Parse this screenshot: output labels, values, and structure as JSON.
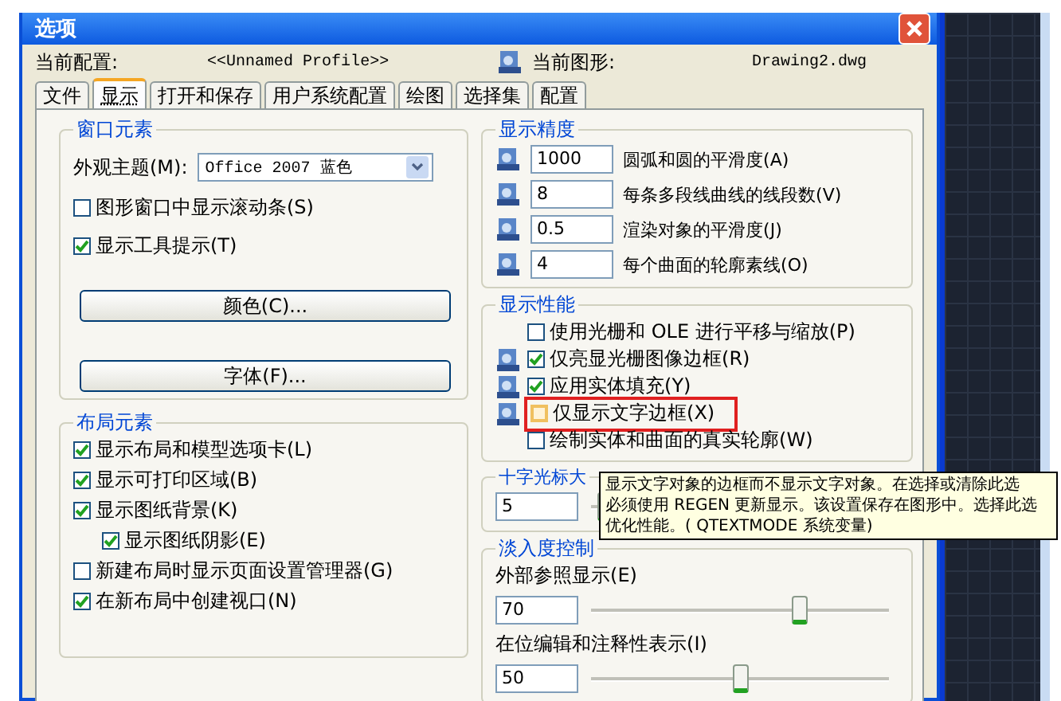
{
  "window": {
    "title": "选项"
  },
  "profile": {
    "label": "当前配置:",
    "value": "<<Unnamed Profile>>",
    "drawing_label": "当前图形:",
    "drawing_value": "Drawing2.dwg"
  },
  "tabs": [
    {
      "label": "文件",
      "selected": false
    },
    {
      "label": "显示",
      "selected": true
    },
    {
      "label": "打开和保存",
      "selected": false
    },
    {
      "label": "用户系统配置",
      "selected": false
    },
    {
      "label": "绘图",
      "selected": false
    },
    {
      "label": "选择集",
      "selected": false
    },
    {
      "label": "配置",
      "selected": false
    }
  ],
  "window_elements": {
    "title": "窗口元素",
    "theme_label": "外观主题(M):",
    "theme_value": "Office 2007 蓝色",
    "checks": [
      {
        "label": "图形窗口中显示滚动条(S)",
        "checked": false
      },
      {
        "label": "显示工具提示(T)",
        "checked": true
      }
    ],
    "buttons": [
      "颜色(C)...",
      "字体(F)..."
    ]
  },
  "layout_elements": {
    "title": "布局元素",
    "checks": [
      {
        "label": "显示布局和模型选项卡(L)",
        "checked": true,
        "indented": false
      },
      {
        "label": "显示可打印区域(B)",
        "checked": true,
        "indented": false
      },
      {
        "label": "显示图纸背景(K)",
        "checked": true,
        "indented": false
      },
      {
        "label": "显示图纸阴影(E)",
        "checked": true,
        "indented": true
      },
      {
        "label": "新建布局时显示页面设置管理器(G)",
        "checked": false,
        "indented": false
      },
      {
        "label": "在新布局中创建视口(N)",
        "checked": true,
        "indented": false
      }
    ]
  },
  "resolution": {
    "title": "显示精度",
    "rows": [
      {
        "value": "1000",
        "label": "圆弧和圆的平滑度(A)"
      },
      {
        "value": "8",
        "label": "每条多段线曲线的线段数(V)"
      },
      {
        "value": "0.5",
        "label": "渲染对象的平滑度(J)"
      },
      {
        "value": "4",
        "label": "每个曲面的轮廓素线(O)"
      }
    ]
  },
  "performance": {
    "title": "显示性能",
    "checks": [
      {
        "label": "使用光栅和 OLE 进行平移与缩放(P)",
        "checked": false,
        "saved_icon": false,
        "highlighted": false
      },
      {
        "label": "仅亮显光栅图像边框(R)",
        "checked": true,
        "saved_icon": true,
        "highlighted": false
      },
      {
        "label": "应用实体填充(Y)",
        "checked": true,
        "saved_icon": true,
        "highlighted": false
      },
      {
        "label": "仅显示文字边框(X)",
        "checked": false,
        "saved_icon": true,
        "highlighted": true
      },
      {
        "label": "绘制实体和曲面的真实轮廓(W)",
        "checked": false,
        "saved_icon": false,
        "highlighted": false
      }
    ]
  },
  "crosshair": {
    "title": "十字光标大",
    "value": "5",
    "level": 0.05
  },
  "fade": {
    "title": "淡入度控制",
    "rows": [
      {
        "label": "外部参照显示(E)",
        "value": "70",
        "level": 0.7
      },
      {
        "label": "在位编辑和注释性表示(I)",
        "value": "50",
        "level": 0.5
      }
    ]
  },
  "tooltip": {
    "lines": [
      "显示文字对象的边框而不显示文字对象。在选择或清除此选",
      "必须使用 REGEN 更新显示。该设置保存在图形中。选择此选",
      "优化性能。( QTEXTMODE 系统变量)"
    ]
  }
}
